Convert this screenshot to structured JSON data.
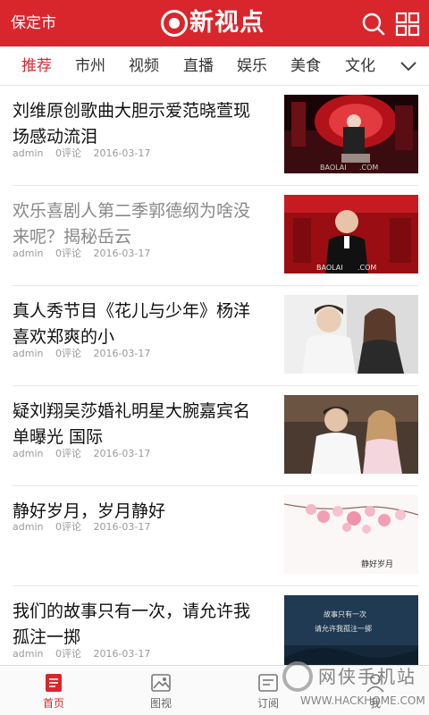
{
  "header": {
    "city": "保定市",
    "logo_text": "新视点",
    "icons": [
      "search-icon",
      "grid-icon"
    ],
    "bg_color": "#d9262c"
  },
  "tabs": {
    "items": [
      "推荐",
      "市州",
      "视频",
      "直播",
      "娱乐",
      "美食",
      "文化"
    ],
    "active": "推荐",
    "more_icon": "chevron-down-icon"
  },
  "feed": {
    "items": [
      {
        "title": "刘维原创歌曲大胆示爱范晓萱现场感动流泪",
        "author": "admin",
        "comments": "0评论",
        "date": "2016-03-17",
        "read": false
      },
      {
        "title": "欢乐喜剧人第二季郭德纲为啥没来呢？揭秘岳云",
        "author": "admin",
        "comments": "0评论",
        "date": "2016-03-17",
        "read": true
      },
      {
        "title": "真人秀节目《花儿与少年》杨洋喜欢郑爽的小",
        "author": "admin",
        "comments": "0评论",
        "date": "2016-03-17",
        "read": false
      },
      {
        "title": "疑刘翔吴莎婚礼明星大腕嘉宾名单曝光 国际",
        "author": "admin",
        "comments": "0评论",
        "date": "2016-03-17",
        "read": false
      },
      {
        "title": "静好岁月，岁月静好",
        "author": "admin",
        "comments": "0评论",
        "date": "2016-03-17",
        "read": false
      },
      {
        "title": "我们的故事只有一次，请允许我孤注一掷",
        "author": "admin",
        "comments": "0评论",
        "date": "2016-03-17",
        "read": false
      }
    ],
    "thumb_texts": {
      "watermark_1": "BAOLAI",
      "watermark_1b": ".COM",
      "watermark_2": "BAOLAI",
      "watermark_2b": ".COM",
      "calligraphy_5": "静好岁月",
      "poem_6_line1": "故事只有一次",
      "poem_6_line2": "请允许我孤注一掷"
    }
  },
  "bottom_nav": {
    "items": [
      {
        "label": "首页",
        "icon": "home-doc-icon",
        "active": true
      },
      {
        "label": "图视",
        "icon": "picture-icon",
        "active": false
      },
      {
        "label": "订阅",
        "icon": "subscribe-icon",
        "active": false
      },
      {
        "label": "我",
        "icon": "user-icon",
        "active": false
      }
    ]
  },
  "watermark": {
    "name": "网侠手机站",
    "url": "WWW.HACKHOME.COM"
  },
  "colors": {
    "accent": "#d9262c",
    "read_title": "#888888",
    "meta": "#9a9a9a"
  }
}
